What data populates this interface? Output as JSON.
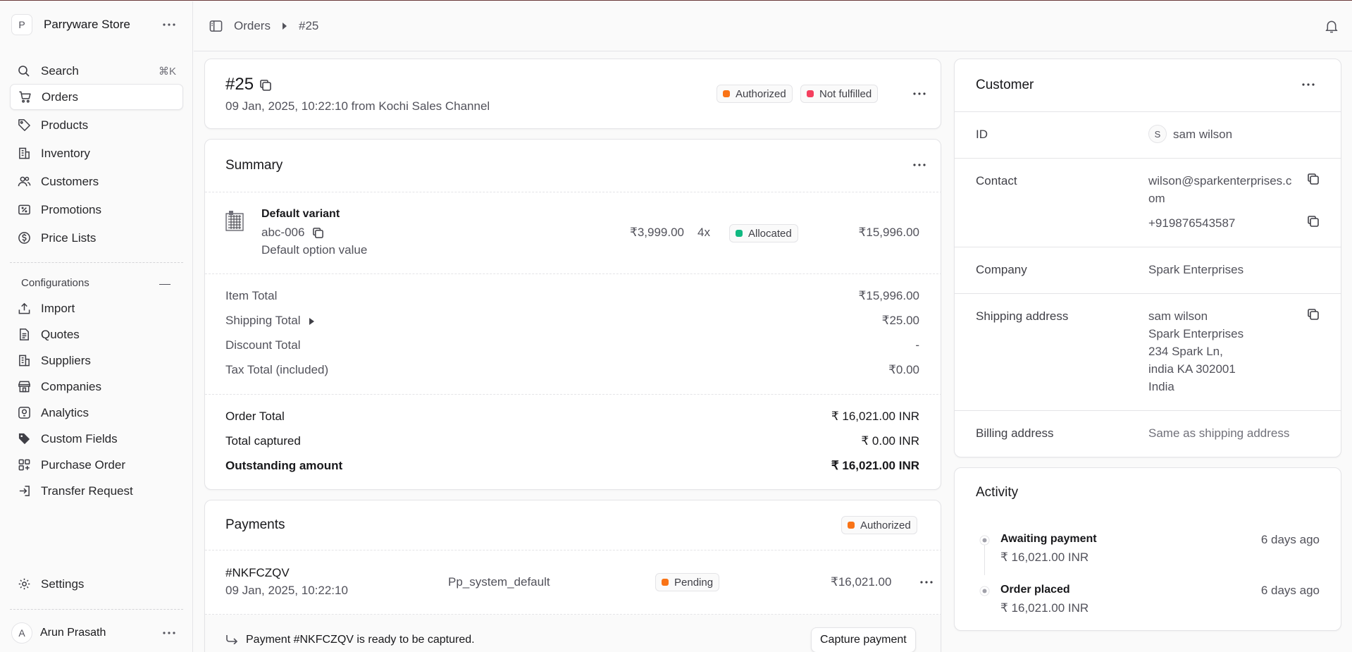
{
  "sidebar": {
    "store_initial": "P",
    "store_name": "Parryware Store",
    "search": {
      "label": "Search",
      "shortcut": "⌘K"
    },
    "nav": [
      {
        "label": "Orders",
        "icon": "cart-icon",
        "active": true
      },
      {
        "label": "Products",
        "icon": "tag-icon"
      },
      {
        "label": "Inventory",
        "icon": "building-icon"
      },
      {
        "label": "Customers",
        "icon": "users-icon"
      },
      {
        "label": "Promotions",
        "icon": "receipt-percent-icon"
      },
      {
        "label": "Price Lists",
        "icon": "currency-icon"
      }
    ],
    "configurations_title": "Configurations",
    "config_items": [
      {
        "label": "Import",
        "icon": "upload-icon"
      },
      {
        "label": "Quotes",
        "icon": "document-icon"
      },
      {
        "label": "Suppliers",
        "icon": "building-icon"
      },
      {
        "label": "Companies",
        "icon": "store-icon"
      },
      {
        "label": "Analytics",
        "icon": "bulb-icon"
      },
      {
        "label": "Custom Fields",
        "icon": "tag-solid-icon"
      },
      {
        "label": "Purchase Order",
        "icon": "grid-plus-icon"
      },
      {
        "label": "Transfer Request",
        "icon": "arrow-in-icon"
      }
    ],
    "settings_label": "Settings",
    "user_initial": "A",
    "user_name": "Arun Prasath"
  },
  "topbar": {
    "breadcrumb": [
      "Orders",
      "#25"
    ]
  },
  "order": {
    "id": "#25",
    "subtitle": "09 Jan, 2025, 10:22:10 from Kochi Sales Channel",
    "badges": [
      {
        "label": "Authorized",
        "color": "#f97316"
      },
      {
        "label": "Not fulfilled",
        "color": "#f43f5e"
      }
    ]
  },
  "summary": {
    "title": "Summary",
    "item": {
      "name": "Default variant",
      "sku": "abc-006",
      "option": "Default option value",
      "unit_price": "₹3,999.00",
      "qty": "4x",
      "status": "Allocated",
      "status_color": "#10b981",
      "total": "₹15,996.00"
    },
    "totals": [
      {
        "label": "Item Total",
        "value": "₹15,996.00"
      },
      {
        "label": "Shipping Total",
        "value": "₹25.00"
      },
      {
        "label": "Discount Total",
        "value": "-"
      },
      {
        "label": "Tax Total (included)",
        "value": "₹0.00"
      }
    ],
    "order_total": {
      "label": "Order Total",
      "value": "₹ 16,021.00 INR"
    },
    "captured": {
      "label": "Total captured",
      "value": "₹ 0.00 INR"
    },
    "outstanding": {
      "label": "Outstanding amount",
      "value": "₹ 16,021.00 INR"
    }
  },
  "payments": {
    "title": "Payments",
    "badge": {
      "label": "Authorized",
      "color": "#f97316"
    },
    "payment": {
      "id": "#NKFCZQV",
      "date": "09 Jan, 2025, 10:22:10",
      "provider": "Pp_system_default",
      "status": "Pending",
      "status_color": "#f97316",
      "amount": "₹16,021.00"
    },
    "notice": "Payment #NKFCZQV is ready to be captured.",
    "capture_button": "Capture payment"
  },
  "customer": {
    "title": "Customer",
    "id_label": "ID",
    "initial": "S",
    "name": "sam wilson",
    "contact_label": "Contact",
    "email_line1": "wilson@sparkenterprises.c",
    "email_line2": "om",
    "phone": "+919876543587",
    "company_label": "Company",
    "company": "Spark Enterprises",
    "shipping_label": "Shipping address",
    "shipping_lines": [
      "sam wilson",
      "Spark Enterprises",
      "234 Spark Ln,",
      "india KA 302001",
      "India"
    ],
    "billing_label": "Billing address",
    "billing_value": "Same as shipping address"
  },
  "activity": {
    "title": "Activity",
    "events": [
      {
        "title": "Awaiting payment",
        "amount": "₹ 16,021.00 INR",
        "time": "6 days ago"
      },
      {
        "title": "Order placed",
        "amount": "₹ 16,021.00 INR",
        "time": "6 days ago"
      }
    ]
  }
}
